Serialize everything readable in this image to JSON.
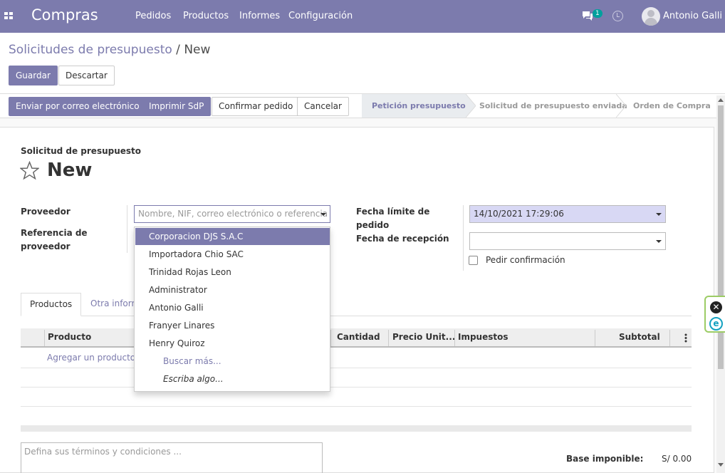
{
  "navbar": {
    "brand": "Compras",
    "menus": [
      "Pedidos",
      "Productos",
      "Informes",
      "Configuración"
    ],
    "chat_count": "1",
    "user_name": "Antonio Galli"
  },
  "breadcrumb": {
    "parent": "Solicitudes de presupuesto",
    "separator": " / ",
    "current": "New"
  },
  "actions": {
    "save": "Guardar",
    "discard": "Descartar"
  },
  "status_buttons": {
    "send_email": "Enviar por correo electrónico",
    "print": "Imprimir SdP",
    "confirm": "Confirmar pedido",
    "cancel": "Cancelar"
  },
  "stages": [
    "Petición presupuesto",
    "Solicitud de presupuesto enviada",
    "Orden de Compra"
  ],
  "active_stage": "Petición presupuesto",
  "form": {
    "doc_label": "Solicitud de presupuesto",
    "title": "New",
    "vendor_label": "Proveedor",
    "vendor_placeholder": "Nombre, NIF, correo electrónico o referencia",
    "vendor_ref_label": "Referencia de proveedor",
    "deadline_label": "Fecha límite de pedido",
    "deadline_value": "14/10/2021 17:29:06",
    "receipt_label": "Fecha de recepción",
    "receipt_value": "",
    "ask_confirm_label": "Pedir confirmación",
    "ask_confirm_checked": false
  },
  "vendor_dropdown": {
    "items": [
      "Corporacion DJS S.A.C",
      "Importadora Chio SAC",
      "Trinidad Rojas Leon",
      "Administrator",
      "Antonio Galli",
      "Franyer Linares",
      "Henry Quiroz"
    ],
    "highlighted": "Corporacion DJS S.A.C",
    "search_more": "Buscar más...",
    "type_something": "Escriba algo..."
  },
  "tabs": [
    "Productos",
    "Otra inform"
  ],
  "table": {
    "columns": [
      "Producto",
      "Cantidad",
      "Precio Unit...",
      "Impuestos",
      "Subtotal"
    ],
    "add_line": "Agregar un producto"
  },
  "terms_placeholder": "Defina sus términos y condiciones ...",
  "totals": {
    "base_label": "Base imponible:",
    "base_value": "S/ 0.00"
  },
  "colors": {
    "primary": "#7c7bad",
    "date_bg": "#d8d8f4",
    "widget_border": "#9ccc65"
  },
  "icons": [
    "apps-icon",
    "chat-icon",
    "clock-icon",
    "avatar",
    "star-icon",
    "close-icon",
    "e-icon",
    "chevron-down-icon",
    "column-options-icon"
  ]
}
